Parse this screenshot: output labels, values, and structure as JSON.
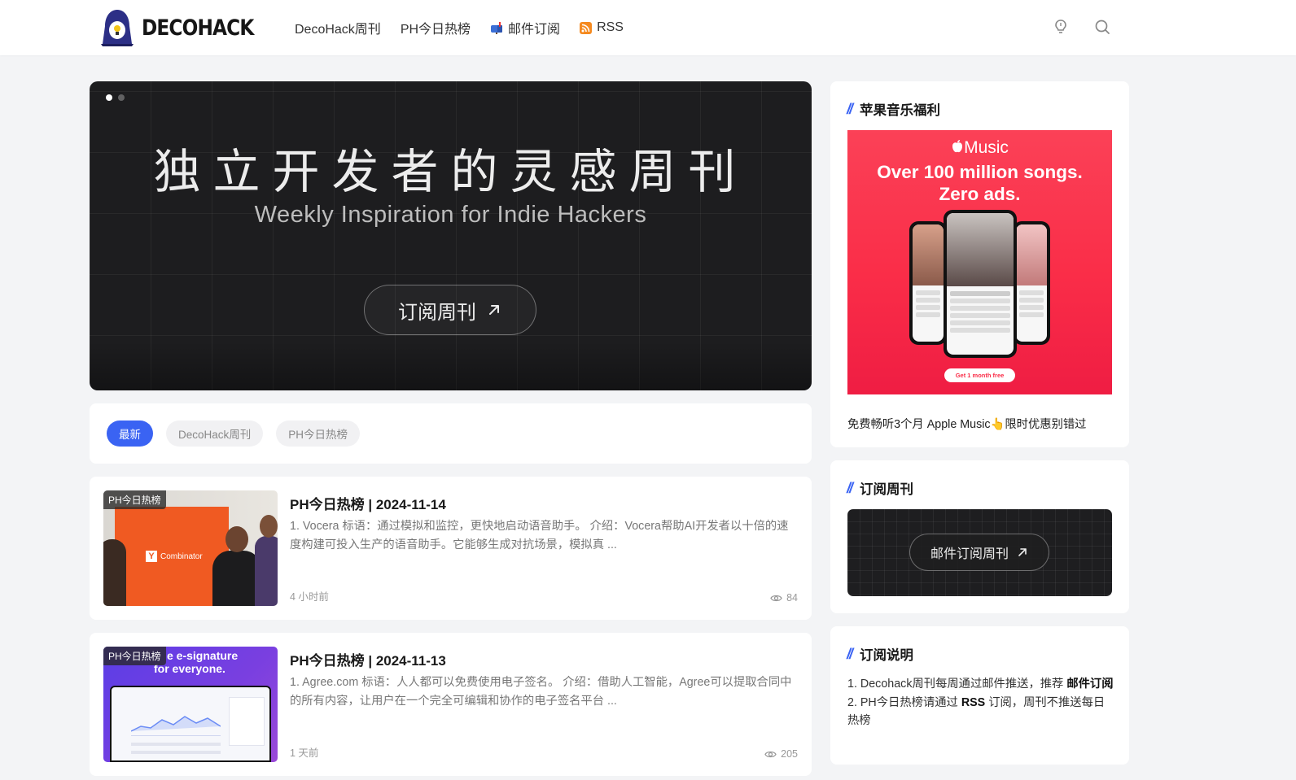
{
  "header": {
    "logo_text": "DECOHACK",
    "nav": [
      {
        "label": "DecoHack周刊",
        "icon": ""
      },
      {
        "label": "PH今日热榜",
        "icon": ""
      },
      {
        "label": "邮件订阅",
        "icon": "mailbox-icon"
      },
      {
        "label": "RSS",
        "icon": "rss-icon"
      }
    ]
  },
  "hero": {
    "title": "独立开发者的灵感周刊",
    "subtitle": "Weekly Inspiration for Indie Hackers",
    "button_label": "订阅周刊",
    "slides": 2,
    "active_slide": 1
  },
  "tabs": [
    {
      "label": "最新",
      "active": true
    },
    {
      "label": "DecoHack周刊",
      "active": false
    },
    {
      "label": "PH今日热榜",
      "active": false
    }
  ],
  "posts": [
    {
      "badge": "PH今日热榜",
      "title": "PH今日热榜 | 2024-11-14",
      "excerpt": "1. Vocera 标语：通过模拟和监控，更快地启动语音助手。 介绍：Vocera帮助AI开发者以十倍的速度构建可投入生产的语音助手。它能够生成对抗场景，模拟真 ...",
      "time": "4 小时前",
      "views": "84",
      "thumb_text": "Combinator",
      "thumb_logo": "Y"
    },
    {
      "badge": "PH今日热榜",
      "title": "PH今日热榜 | 2024-11-13",
      "excerpt": "1. Agree.com 标语：人人都可以免费使用电子签名。 介绍：借助人工智能，Agree可以提取合同中的所有内容，让用户在一个完全可编辑和协作的电子签名平台 ...",
      "time": "1 天前",
      "views": "205",
      "thumb_line1": "e e-signature",
      "thumb_line2": "for everyone."
    }
  ],
  "sidebar": {
    "music": {
      "heading": "苹果音乐福利",
      "ad_logo": "Music",
      "ad_headline_1": "Over 100 million songs.",
      "ad_headline_2": "Zero ads.",
      "ad_button": "Get 1 month free",
      "description": "免费畅听3个月 Apple Music👆限时优惠别错过"
    },
    "subscribe": {
      "heading": "订阅周刊",
      "button_label": "邮件订阅周刊"
    },
    "notes": {
      "heading": "订阅说明",
      "line1_prefix": "1. Decohack周刊每周通过邮件推送，推荐 ",
      "line1_bold": "邮件订阅",
      "line2_prefix": "2. PH今日热榜请通过 ",
      "line2_bold": "RSS",
      "line2_suffix": " 订阅，周刊不推送每日热榜"
    }
  },
  "colors": {
    "accent": "#3a63f3",
    "music_red": "#fa2d48",
    "hero_bg": "#1d1d1f"
  }
}
